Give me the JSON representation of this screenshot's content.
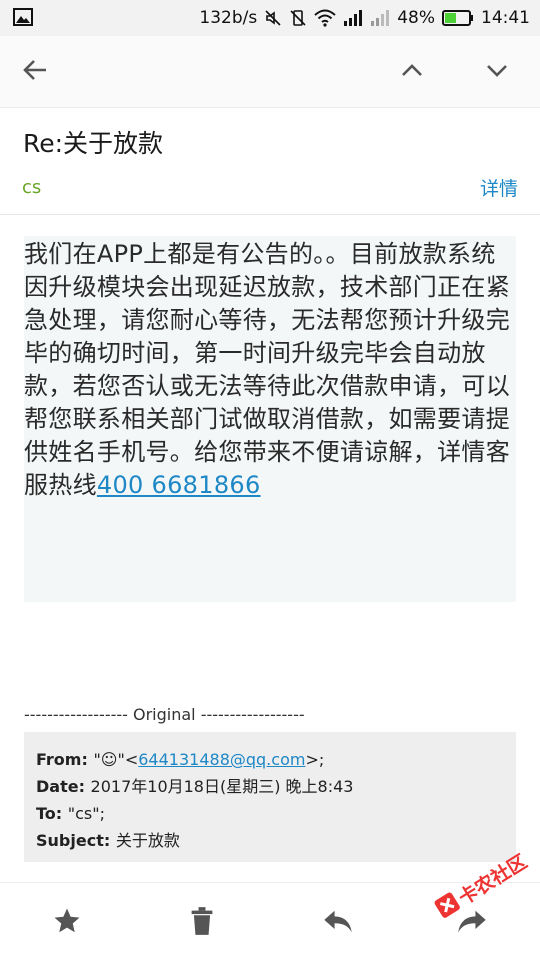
{
  "status_bar": {
    "network_speed": "132b/s",
    "battery_percent": "48%",
    "battery_level": 0.48,
    "time": "14:41",
    "icons": [
      "image-icon",
      "mute-icon",
      "vibrate-icon",
      "wifi-icon",
      "signal-icon",
      "signal-icon-2",
      "battery-icon"
    ]
  },
  "app_bar": {
    "icons": [
      "back-arrow-icon",
      "chevron-up-icon",
      "chevron-down-icon"
    ]
  },
  "email": {
    "subject": "Re:关于放款",
    "sender": "cs",
    "details_label": "详情",
    "body_text": "我们在APP上都是有公告的。。目前放款系统因升级模块会出现延迟放款，技术部门正在紧急处理，请您耐心等待，无法帮您预计升级完毕的确切时间，第一时间升级完毕会自动放款，若您否认或无法等待此次借款申请，可以帮您联系相关部门试做取消借款，如需要请提供姓名手机号。给您带来不便请谅解，详情客服热线",
    "hotline": "400 6681866",
    "original_separator": "------------------ Original ------------------",
    "quoted": {
      "from_label": "From: ",
      "from_name": "\"☺\"<",
      "from_email": "644131488@qq.com",
      "from_suffix": ">;",
      "date_label": "Date: ",
      "date_value": "2017年10月18日(星期三) 晚上8:43",
      "to_label": "To: ",
      "to_value": "\"cs\";",
      "subject_label": "Subject: ",
      "subject_value": "关于放款"
    }
  },
  "toolbar": {
    "icons": [
      "star-icon",
      "trash-icon",
      "reply-icon",
      "forward-icon"
    ]
  },
  "watermark": {
    "text": "卡农社区"
  },
  "colors": {
    "link": "#1e88c7",
    "sender": "#6aa52a",
    "battery": "#4cd137"
  }
}
